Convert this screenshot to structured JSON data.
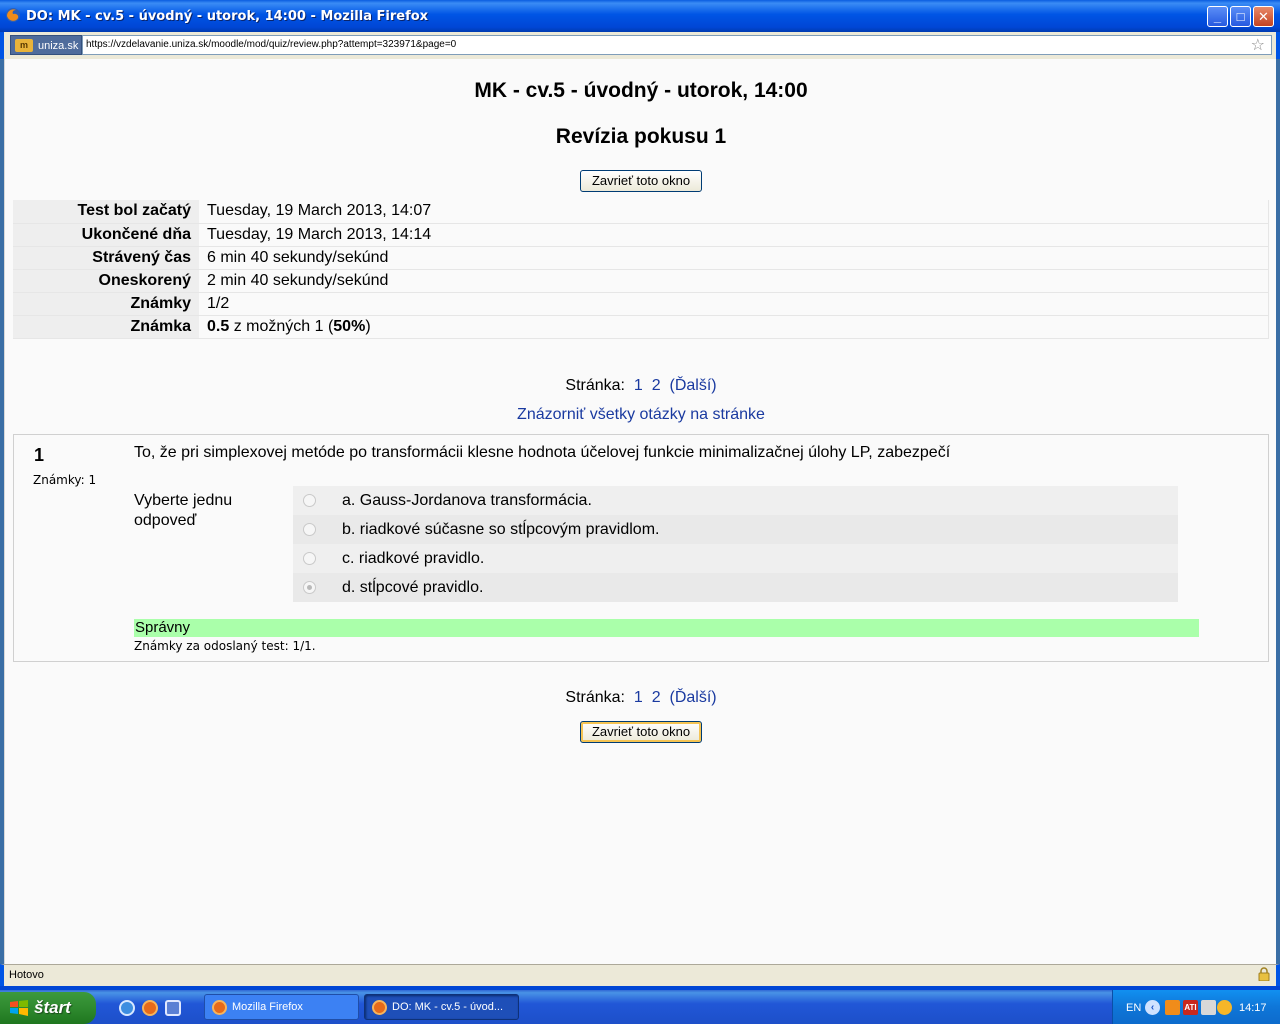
{
  "window": {
    "title": "DO: MK - cv.5 - úvodný - utorok, 14:00 - Mozilla Firefox",
    "minimize": "_",
    "maximize": "□",
    "close": "✕"
  },
  "addressbar": {
    "site_badge": "uniza.sk",
    "url": "https://vzdelavanie.uniza.sk/moodle/mod/quiz/review.php?attempt=323971&page=0"
  },
  "page": {
    "quiz_title": "MK - cv.5 - úvodný - utorok, 14:00",
    "review_title": "Revízia pokusu 1",
    "close_button": "Zavrieť toto okno",
    "summary": [
      {
        "label": "Test bol začatý",
        "value": "Tuesday, 19 March 2013, 14:07"
      },
      {
        "label": "Ukončené dňa",
        "value": "Tuesday, 19 March 2013, 14:14"
      },
      {
        "label": "Strávený čas",
        "value": "6 min 40 sekundy/sekúnd"
      },
      {
        "label": "Oneskorený",
        "value": "2 min 40 sekundy/sekúnd"
      },
      {
        "label": "Známky",
        "value": "1/2"
      },
      {
        "label": "Známka",
        "value_bold1": "0.5",
        "value_mid": " z možných 1 (",
        "value_bold2": "50%",
        "value_end": ")"
      }
    ],
    "paging": {
      "label": "Stránka:",
      "pages": [
        "1",
        "2"
      ],
      "next": "(Ďalší)"
    },
    "show_all": "Znázorniť všetky otázky na stránke",
    "question": {
      "number": "1",
      "marks": "Známky: 1",
      "text": "To, že pri simplexovej metóde po transformácii klesne hodnota účelovej funkcie minimalizačnej úlohy LP, zabezpečí",
      "prompt": "Vyberte jednu odpoveď",
      "answers": [
        {
          "label": "a. Gauss-Jordanova transformácia.",
          "selected": false
        },
        {
          "label": "b. riadkové súčasne so stĺpcovým pravidlom.",
          "selected": false
        },
        {
          "label": "c. riadkové pravidlo.",
          "selected": false
        },
        {
          "label": "d. stĺpcové pravidlo.",
          "selected": true
        }
      ],
      "result": "Správny",
      "result_color": "#aaffaa",
      "result_note": "Známky za odoslaný test: 1/1."
    }
  },
  "statusbar": {
    "text": "Hotovo"
  },
  "taskbar": {
    "start": "štart",
    "tasks": [
      "Mozilla Firefox",
      "DO: MK - cv.5 - úvod..."
    ],
    "tray_lang": "EN",
    "tray_ati": "ATI",
    "clock": "14:17"
  }
}
